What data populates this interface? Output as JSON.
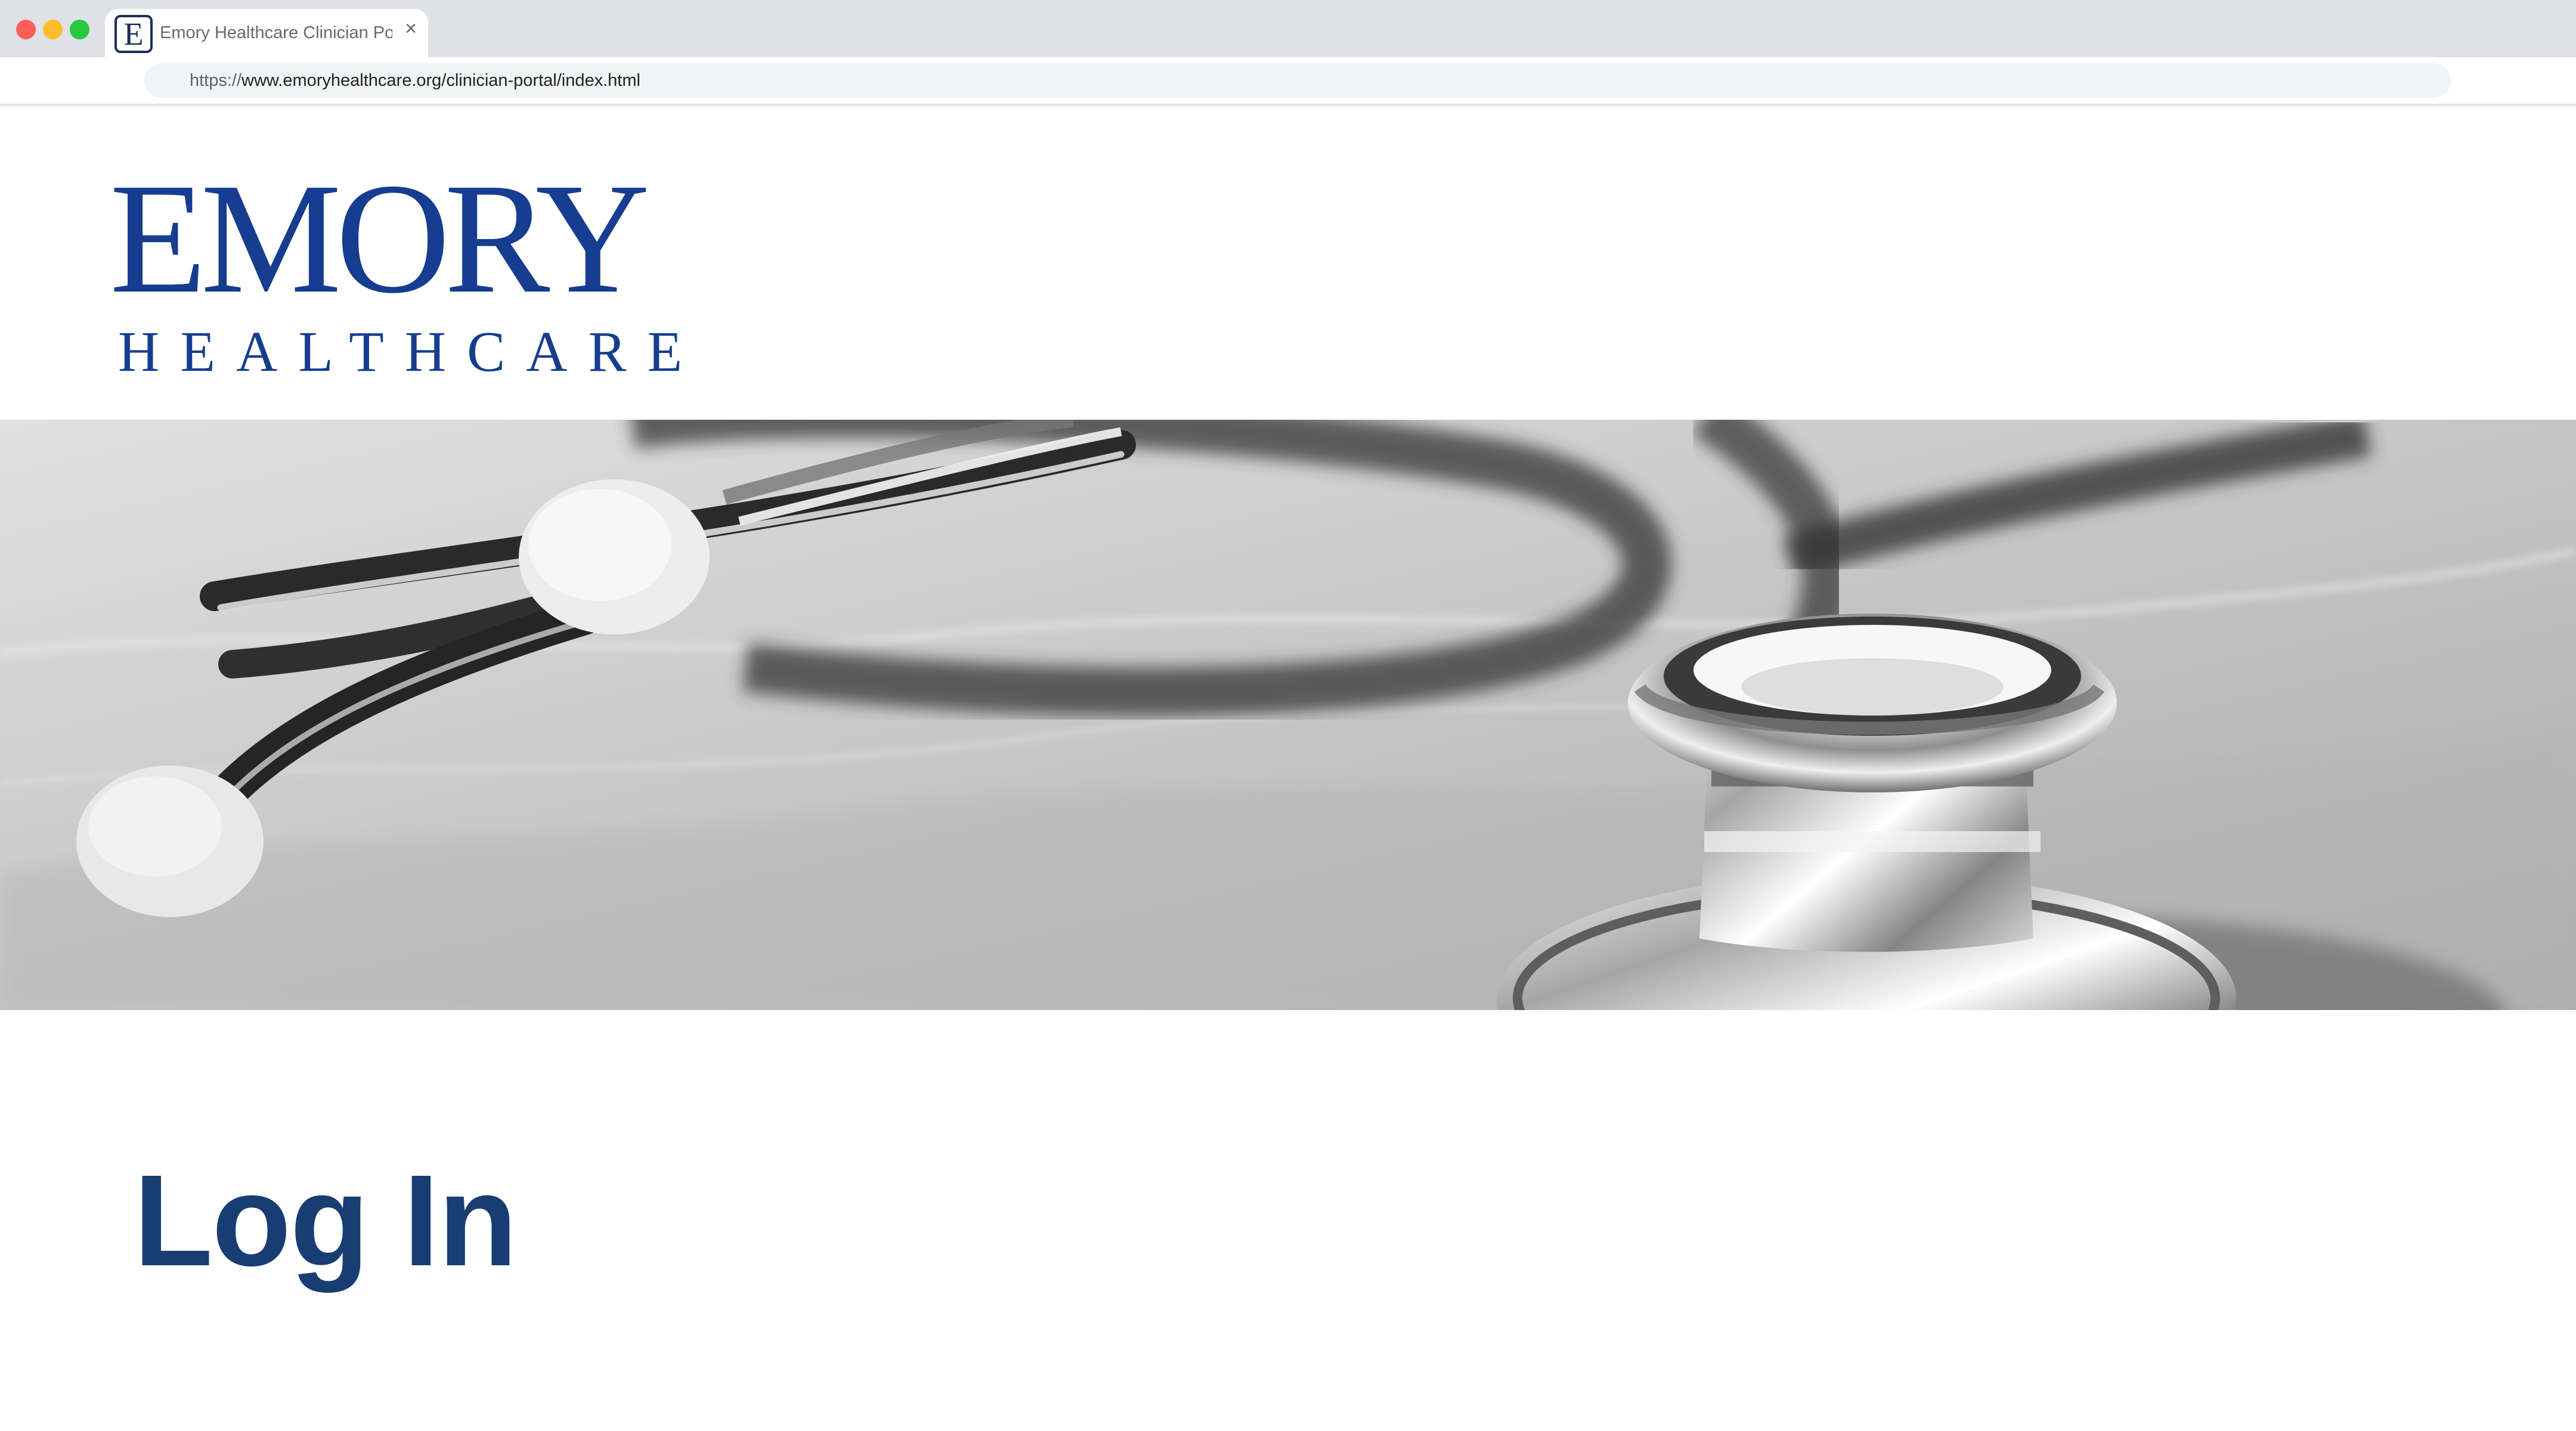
{
  "browser": {
    "tab": {
      "title": "Emory Healthcare Clinician Por",
      "favicon_letter": "E",
      "close_label": "×"
    },
    "address": {
      "scheme": "https://",
      "host_path": "www.emoryhealthcare.org/clinician-portal/index.html"
    }
  },
  "header": {
    "logo": {
      "primary": "EMORY",
      "secondary": "HEALTHCARE"
    }
  },
  "main": {
    "hero_image": "stethoscope-photo",
    "heading": "Log In"
  },
  "colors": {
    "brand_blue": "#163d8f",
    "heading_blue": "#173d73",
    "tab_strip": "#dee1e6"
  }
}
